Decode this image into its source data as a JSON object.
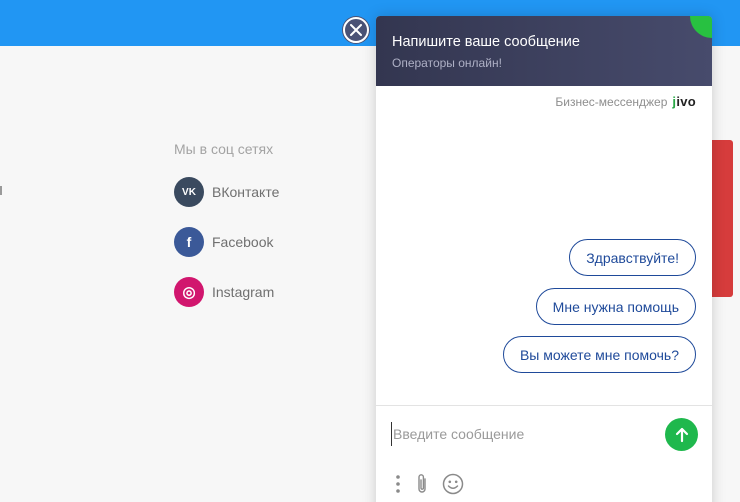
{
  "site": {
    "social": {
      "title": "Мы в соц сетях",
      "items": [
        {
          "label": "ВКонтакте",
          "icon": "vk-icon",
          "color": "#3a4a5f",
          "glyph": "VK"
        },
        {
          "label": "Facebook",
          "icon": "facebook-icon",
          "color": "#3b5998",
          "glyph": "f"
        },
        {
          "label": "Instagram",
          "icon": "instagram-icon",
          "color": "#d1166e",
          "glyph": "◎"
        }
      ]
    },
    "colors": {
      "topbar": "#2196f3",
      "accent_red": "#d63c3c"
    }
  },
  "chat": {
    "header": {
      "title": "Напишите ваше сообщение",
      "subtitle": "Операторы онлайн!"
    },
    "branding": {
      "text": "Бизнес-мессенджер",
      "logo_j": "j",
      "logo_rest": "ivo"
    },
    "quick_replies": [
      "Здравствуйте!",
      "Мне нужна помощь",
      "Вы можете мне помочь?"
    ],
    "input": {
      "placeholder": "Введите сообщение",
      "value": ""
    },
    "icons": {
      "close": "close-icon",
      "send": "send-arrow-icon",
      "menu": "more-vertical-icon",
      "attach": "paperclip-icon",
      "emoji": "emoji-icon"
    },
    "colors": {
      "header": "#393c5a",
      "online": "#28c141",
      "send": "#1fb84d",
      "reply_border": "#1f4a9a"
    }
  }
}
